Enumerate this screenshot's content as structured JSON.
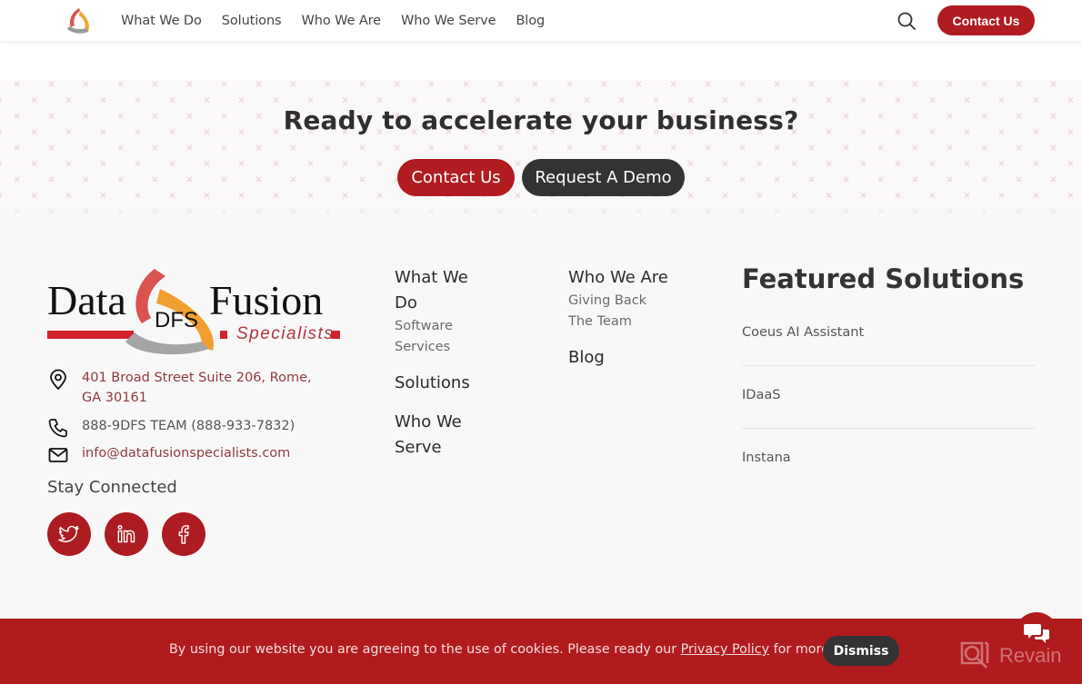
{
  "header": {
    "logo_alt": "Data Fusion Specialists",
    "nav": [
      "What We Do",
      "Solutions",
      "Who We Are",
      "Who We Serve",
      "Blog"
    ],
    "search_icon": "search-icon",
    "contact_label": "Contact Us"
  },
  "cta": {
    "title": "Ready to accelerate your business?",
    "contact_label": "Contact Us",
    "demo_label": "Request A Demo"
  },
  "footer": {
    "logo": {
      "word1": "Data",
      "word2": "Fusion",
      "badge": "DFS",
      "tagline": "Specialists"
    },
    "address": "401 Broad Street Suite 206, Rome, GA 30161",
    "phone": "888-9DFS TEAM (888-933-7832)",
    "email": "info@datafusionspecialists.com",
    "stay_connected": "Stay Connected",
    "socials": [
      "twitter-icon",
      "linkedin-icon",
      "facebook-icon"
    ],
    "col1": {
      "heading": "What We Do",
      "links": [
        "Software",
        "Services"
      ],
      "heading2": "Solutions",
      "heading3": "Who We Serve"
    },
    "col2": {
      "heading": "Who We Are",
      "links": [
        "Giving Back",
        "The Team"
      ],
      "heading2": "Blog"
    },
    "featured": {
      "title": "Featured Solutions",
      "items": [
        "Coeus AI Assistant",
        "IDaaS",
        "Instana"
      ]
    }
  },
  "cookie": {
    "text_before": "By using our website you are agreeing to the use of cookies. Please ready our ",
    "link": "Privacy Policy",
    "text_after": " for more info.",
    "dismiss_label": "Dismiss"
  },
  "watermark": "Revain",
  "colors": {
    "brand_red": "#b01c20",
    "dark_button": "#333333",
    "footer_bg": "#f8f8f8",
    "link_red": "#8f3a3e"
  }
}
